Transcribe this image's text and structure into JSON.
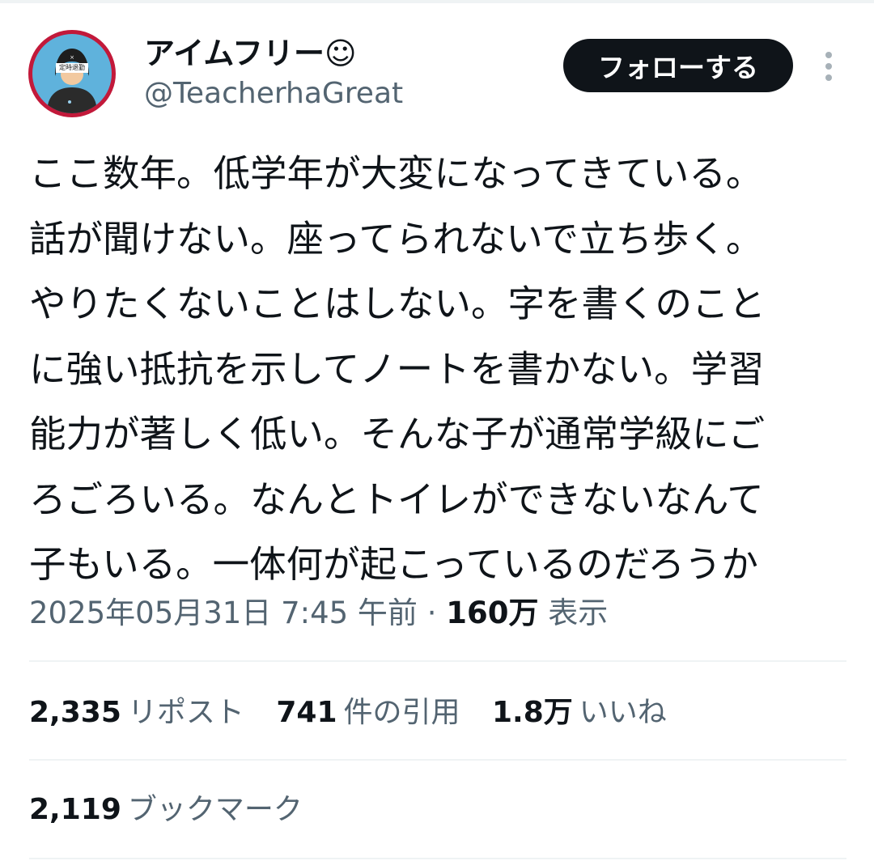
{
  "author": {
    "display_name": "アイムフリー☺",
    "handle": "@TeacherhaGreat",
    "avatar_badge_text": "定時退勤"
  },
  "follow_button_label": "フォローする",
  "tweet_lines": [
    "ここ数年。低学年が大変になってきている。",
    "話が聞けない。座ってられないで立ち歩く。",
    "やりたくないことはしない。字を書くのこと",
    "に強い抵抗を示してノートを書かない。学習",
    "能力が著しく低い。そんな子が通常学級にご",
    "ろごろいる。なんとトイレができないなんて",
    "子もいる。一体何が起こっているのだろうか"
  ],
  "meta": {
    "timestamp": "2025年05月31日 7:45 午前",
    "separator": "·",
    "views_count": "160万",
    "views_label": "表示"
  },
  "stats": {
    "reposts_count": "2,335",
    "reposts_label": "リポスト",
    "quotes_count": "741",
    "quotes_label": "件の引用",
    "likes_count": "1.8万",
    "likes_label": "いいね",
    "bookmarks_count": "2,119",
    "bookmarks_label": "ブックマーク"
  },
  "icons": [
    "more-options-icon"
  ],
  "colors": {
    "primary_text": "#0f1419",
    "secondary_text": "#536471",
    "follow_button_bg": "#0f1419",
    "follow_button_text": "#ffffff",
    "divider": "#eff3f4",
    "avatar_ring": "#c2193a",
    "avatar_bg": "#5fb2dc"
  }
}
